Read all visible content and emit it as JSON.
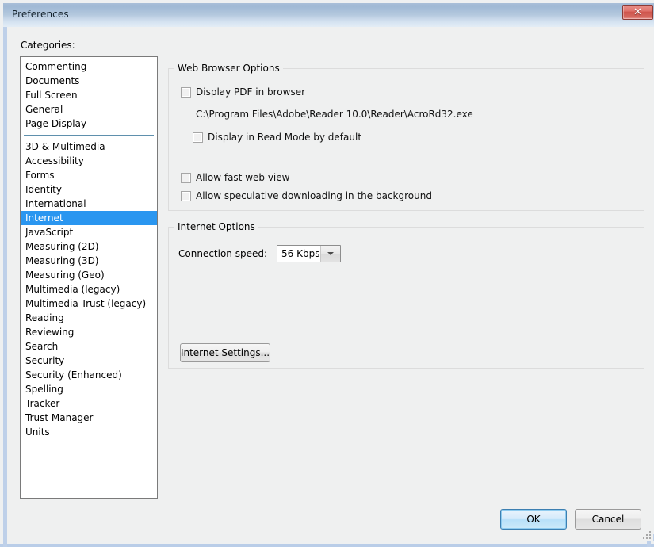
{
  "window": {
    "title": "Preferences",
    "close_icon": "close-icon",
    "close_glyph": "✕"
  },
  "sidebar": {
    "label": "Categories:",
    "selected": "Internet",
    "items": [
      {
        "label": "Commenting",
        "type": "item"
      },
      {
        "label": "Documents",
        "type": "item"
      },
      {
        "label": "Full Screen",
        "type": "item"
      },
      {
        "label": "General",
        "type": "item"
      },
      {
        "label": "Page Display",
        "type": "item"
      },
      {
        "label": "",
        "type": "separator"
      },
      {
        "label": "3D & Multimedia",
        "type": "item"
      },
      {
        "label": "Accessibility",
        "type": "item"
      },
      {
        "label": "Forms",
        "type": "item"
      },
      {
        "label": "Identity",
        "type": "item"
      },
      {
        "label": "International",
        "type": "item"
      },
      {
        "label": "Internet",
        "type": "item"
      },
      {
        "label": "JavaScript",
        "type": "item"
      },
      {
        "label": "Measuring (2D)",
        "type": "item"
      },
      {
        "label": "Measuring (3D)",
        "type": "item"
      },
      {
        "label": "Measuring (Geo)",
        "type": "item"
      },
      {
        "label": "Multimedia (legacy)",
        "type": "item"
      },
      {
        "label": "Multimedia Trust (legacy)",
        "type": "item"
      },
      {
        "label": "Reading",
        "type": "item"
      },
      {
        "label": "Reviewing",
        "type": "item"
      },
      {
        "label": "Search",
        "type": "item"
      },
      {
        "label": "Security",
        "type": "item"
      },
      {
        "label": "Security (Enhanced)",
        "type": "item"
      },
      {
        "label": "Spelling",
        "type": "item"
      },
      {
        "label": "Tracker",
        "type": "item"
      },
      {
        "label": "Trust Manager",
        "type": "item"
      },
      {
        "label": "Units",
        "type": "item"
      }
    ]
  },
  "web_browser_options": {
    "title": "Web Browser Options",
    "display_pdf_in_browser": "Display PDF in browser",
    "display_pdf_checked": false,
    "reader_path": "C:\\Program Files\\Adobe\\Reader 10.0\\Reader\\AcroRd32.exe",
    "display_read_mode": "Display in Read Mode by default",
    "display_read_mode_checked": false,
    "allow_fast_web_view": "Allow fast web view",
    "allow_fast_web_view_checked": false,
    "allow_speculative": "Allow speculative downloading in the background",
    "allow_speculative_checked": false
  },
  "internet_options": {
    "title": "Internet Options",
    "connection_speed_label": "Connection speed:",
    "connection_speed_value": "56 Kbps",
    "dropdown_icon": "chevron-down-icon",
    "internet_settings_button": "Internet Settings..."
  },
  "footer": {
    "ok_label": "OK",
    "cancel_label": "Cancel"
  },
  "colors": {
    "selection_blue": "#2a96f0",
    "titlebar_blue": "#b3c8de",
    "close_red": "#cf554d",
    "separator": "#5f90ad"
  }
}
